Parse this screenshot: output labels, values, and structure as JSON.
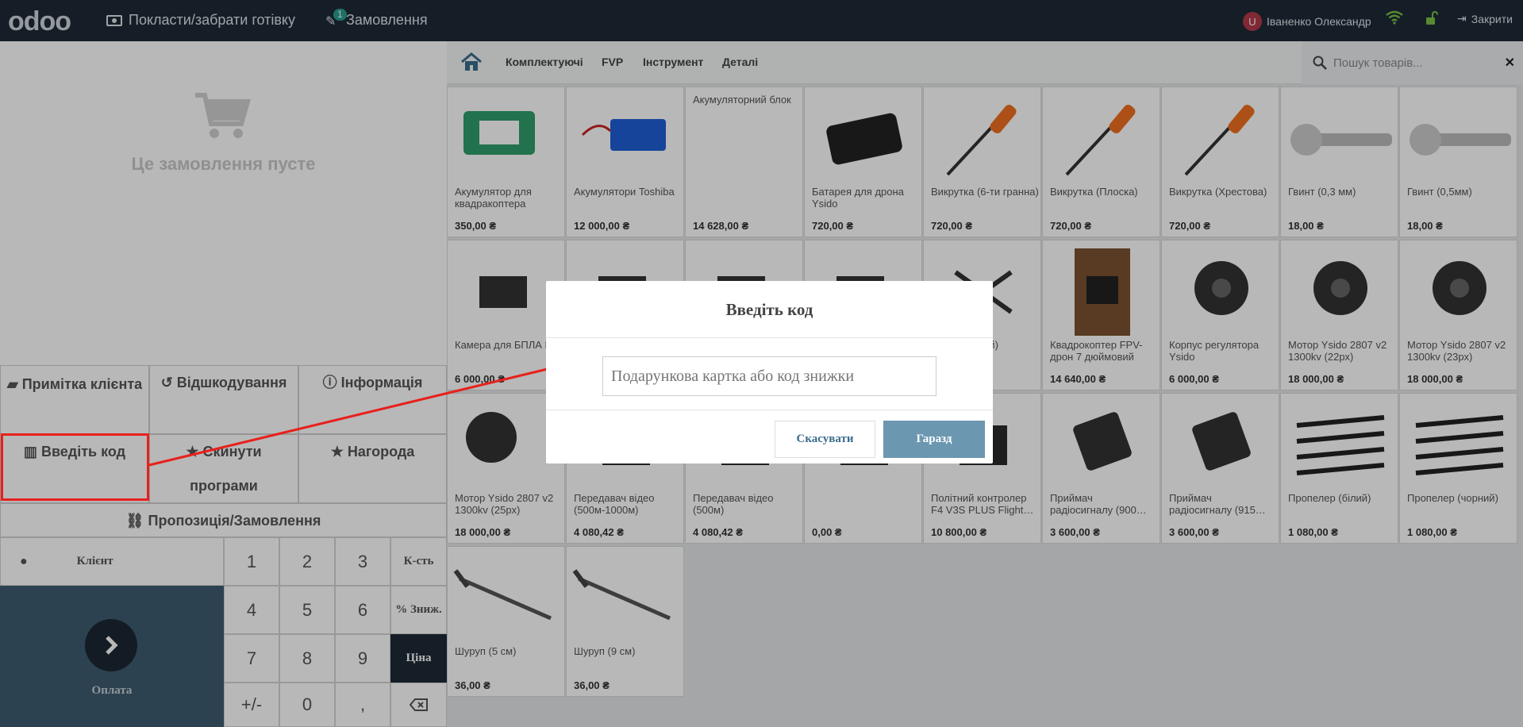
{
  "topbar": {
    "logo": "odoo",
    "cash_label": "Покласти/забрати готівку",
    "orders_label": "Замовлення",
    "orders_count": "1",
    "user_initial": "U",
    "user_name": "Іваненко Олександр",
    "close_label": "Закрити"
  },
  "order": {
    "empty_message": "Це замовлення пусте"
  },
  "controls": {
    "customer_note": "Примітка клієнта",
    "customer_note_2": "клієнта",
    "refund": "Відшкодування",
    "info": "Інформація",
    "enter_code": "Введіть код",
    "reset_programs": "Скинути",
    "reset_programs_2": "програми",
    "reward": "Нагорода",
    "quotation": "Пропозиція/Замовлення"
  },
  "numpad": {
    "customer": "Клієнт",
    "keys": [
      "1",
      "2",
      "3",
      "4",
      "5",
      "6",
      "7",
      "8",
      "9",
      "+/-",
      "0",
      ","
    ],
    "qty": "К-сть",
    "disc": "% Зниж.",
    "price": "Ціна",
    "payment": "Оплата"
  },
  "categories": [
    "Комплектуючі",
    "FVP",
    "Інструмент",
    "Деталі"
  ],
  "search": {
    "placeholder": "Пошук товарів..."
  },
  "products": [
    {
      "name": "Акумулятор для квадракоптера",
      "price": "350,00 ₴"
    },
    {
      "name": "Акумулятори Toshiba",
      "price": "12 000,00 ₴"
    },
    {
      "name": "Акумуляторний блок",
      "price": "14 628,00 ₴"
    },
    {
      "name": "Батарея для дрона Ysido",
      "price": "720,00 ₴"
    },
    {
      "name": "Викрутка (6-ти гранна)",
      "price": "720,00 ₴"
    },
    {
      "name": "Викрутка (Плоска)",
      "price": "720,00 ₴"
    },
    {
      "name": "Викрутка (Хрестова)",
      "price": "720,00 ₴"
    },
    {
      "name": "Гвинт (0,3 мм)",
      "price": "18,00 ₴"
    },
    {
      "name": "Гвинт (0,5мм)",
      "price": "18,00 ₴"
    },
    {
      "name": "Камера для БПЛА Mn)",
      "price": "6 000,00 ₴"
    },
    {
      "name": "",
      "price": ""
    },
    {
      "name": "",
      "price": ""
    },
    {
      "name": "",
      "price": ""
    },
    {
      "name": "корпус (білий)",
      "price": ""
    },
    {
      "name": "Квадрокоптер FPV-дрон 7 дюймовий",
      "price": "14 640,00 ₴"
    },
    {
      "name": "Корпус регулятора Ysido",
      "price": "6 000,00 ₴"
    },
    {
      "name": "Мотор Ysido 2807 v2 1300kv (22px)",
      "price": "18 000,00 ₴"
    },
    {
      "name": "Мотор Ysido 2807 v2 1300kv (23px)",
      "price": "18 000,00 ₴"
    },
    {
      "name": "Мотор Ysido 2807 v2 1300kv (25px)",
      "price": "18 000,00 ₴"
    },
    {
      "name": "Передавач відео (500м-1000м)",
      "price": "4 080,42 ₴"
    },
    {
      "name": "Передавач відео (500м)",
      "price": "4 080,42 ₴"
    },
    {
      "name": "",
      "price": "0,00 ₴"
    },
    {
      "name": "Політний контролер F4 V3S PLUS Flight…",
      "price": "10 800,00 ₴"
    },
    {
      "name": "Приймач радіосигналу (900…",
      "price": "3 600,00 ₴"
    },
    {
      "name": "Приймач радіосигналу (915…",
      "price": "3 600,00 ₴"
    },
    {
      "name": "Пропелер (білий)",
      "price": "1 080,00 ₴"
    },
    {
      "name": "Пропелер (чорний)",
      "price": "1 080,00 ₴"
    },
    {
      "name": "Шуруп (5 см)",
      "price": "36,00 ₴"
    },
    {
      "name": "Шуруп (9 см)",
      "price": "36,00 ₴"
    }
  ],
  "dialog": {
    "title": "Введіть код",
    "input_placeholder": "Подарункова картка або код знижки",
    "cancel": "Скасувати",
    "ok": "Гаразд"
  },
  "colors": {
    "topbar": "#1e2a36",
    "payment": "#3f5c6f",
    "ok_button": "#6b97b1",
    "annotation": "#e8201c"
  }
}
